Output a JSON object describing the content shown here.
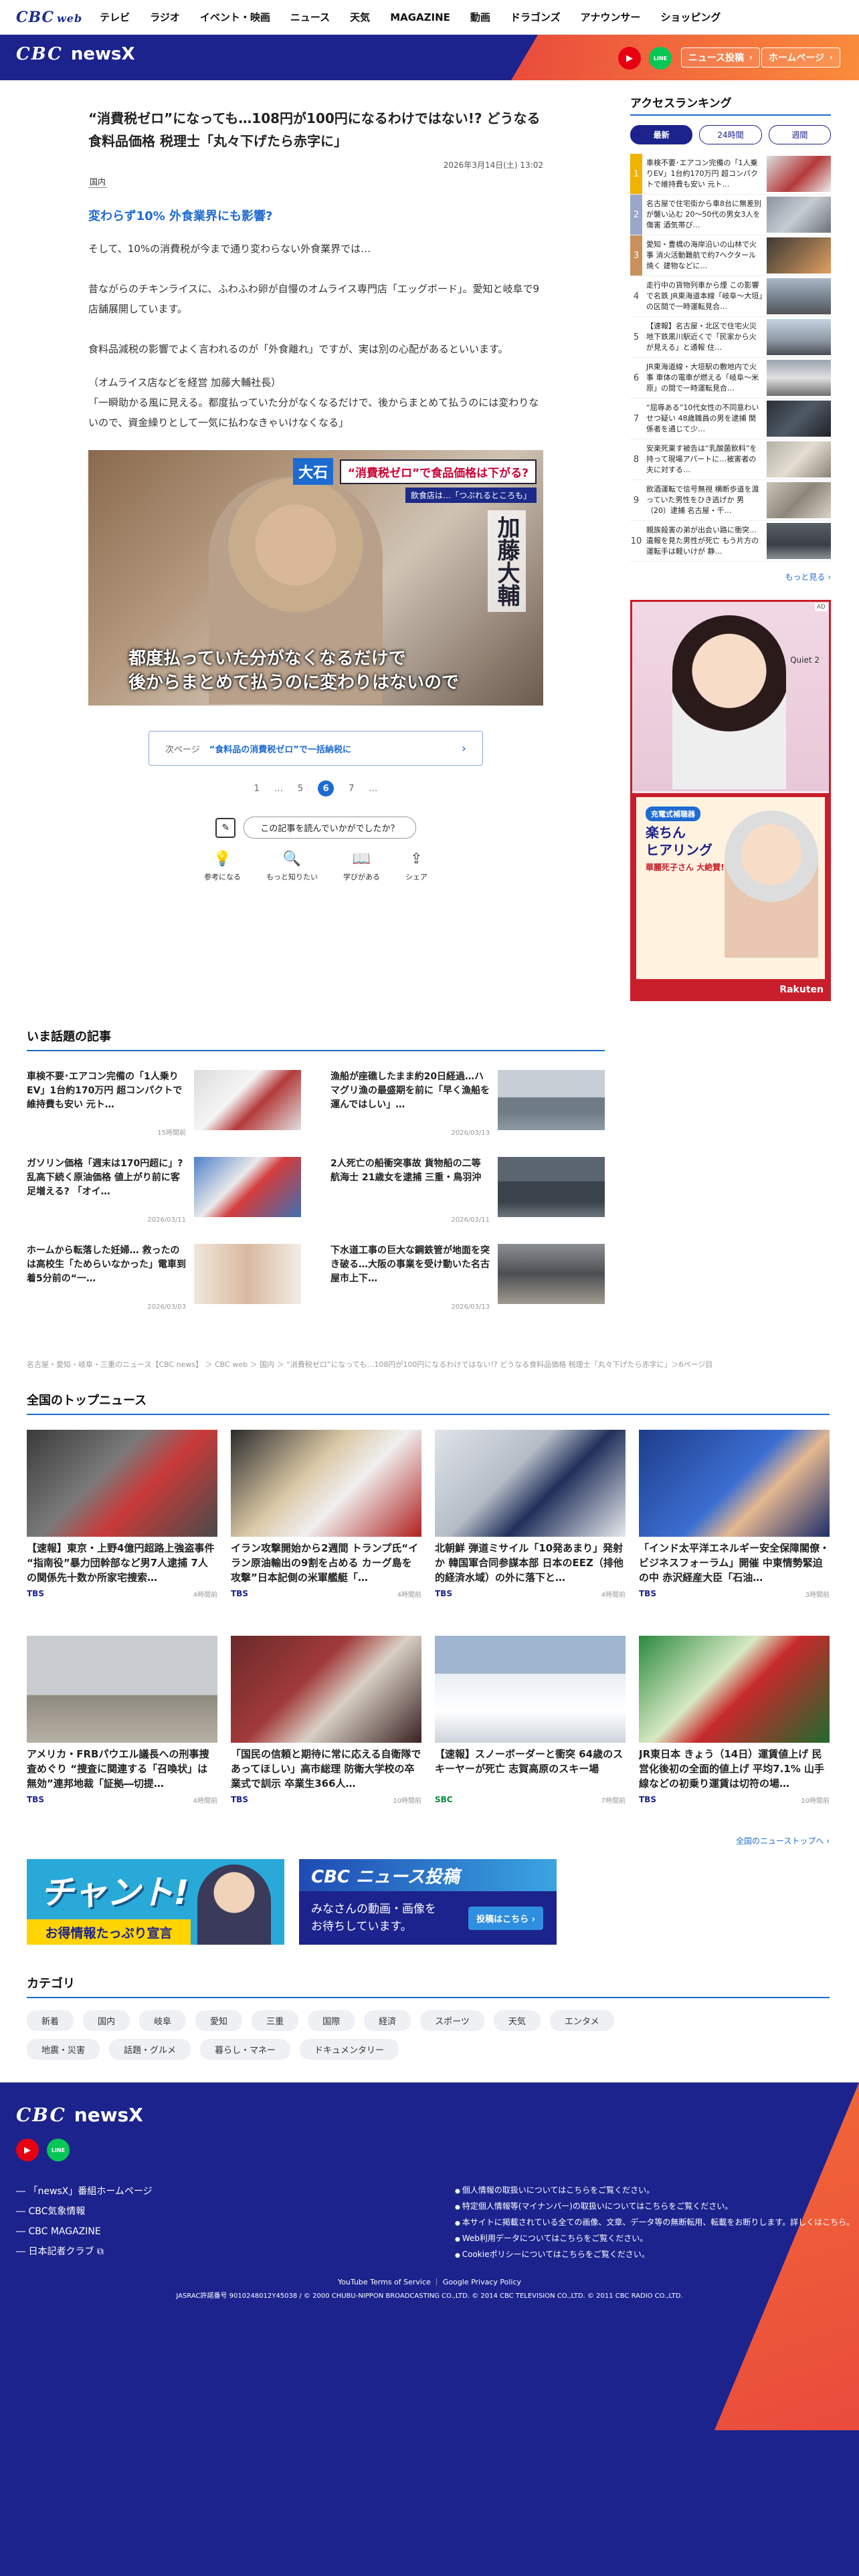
{
  "topnav": {
    "logo_cbc": "CBC",
    "logo_web": "web",
    "items": [
      "テレビ",
      "ラジオ",
      "イベント・映画",
      "ニュース",
      "天気",
      "MAGAZINE",
      "動画",
      "ドラゴンズ",
      "アナウンサー",
      "ショッピング"
    ]
  },
  "header": {
    "logo_cbc": "CBC",
    "logo_newsx": "newsX",
    "youtube": "▶",
    "line": "LINE",
    "btn_submit": "ニュース投稿",
    "btn_home": "ホームページ"
  },
  "article": {
    "title": "“消費税ゼロ”になっても…108円が100円になるわけではない!? どうなる食料品価格 税理士「丸々下げたら赤字に」",
    "date": "2026年3月14日(土) 13:02",
    "tag": "国内",
    "subhead": "変わらず10% 外食業界にも影響?",
    "p1": "そして、10%の消費税が今まで通り変わらない外食業界では…",
    "p2": "昔ながらのチキンライスに、ふわふわ卵が自慢のオムライス専門店「エッグボード」。愛知と岐阜で9店舗展開しています。",
    "p3": "食料品減税の影響でよく言われるのが「外食離れ」ですが、実は別の心配があるといいます。",
    "p4": "（オムライス店などを経営 加藤大輔社長）\n「一瞬助かる風に見える。都度払っていた分がなくなるだけで、後からまとめて払うのには変わりないので、資金繰りとして一気に払わなきゃいけなくなる」",
    "photo": {
      "ohishi": "大石",
      "banner": "“消費税ゼロ”で食品価格は下がる?",
      "banner_sub": "飲食店は…「つぶれるところも」",
      "name": "加藤大輔",
      "caption_1": "都度払っていた分がなくなるだけで",
      "caption_2": "後からまとめて払うのに変わりはないので"
    },
    "next_label": "次ページ",
    "next_title": "“食料品の消費税ゼロ”で一括納税に",
    "next_chev": "›",
    "pages": [
      "1",
      "…",
      "5",
      "6",
      "7",
      "…"
    ],
    "feedback_q": "この記事を読んでいかがでしたか？",
    "reactions": [
      {
        "icon": "💡",
        "label": "参考になる"
      },
      {
        "icon": "🔍",
        "label": "もっと知りたい"
      },
      {
        "icon": "📖",
        "label": "学びがある"
      },
      {
        "icon": "⇪",
        "label": "シェア"
      }
    ]
  },
  "hot": {
    "title": "いま話題の記事",
    "items": [
      {
        "t": "車検不要･エアコン完備の「1人乗りEV」1台約170万円 超コンパクトで維持費も安い 元ト…",
        "d": "15時間前"
      },
      {
        "t": "漁船が座礁したまま約20日経過…ハマグリ漁の最盛期を前に「早く漁船を運んではしい」…",
        "d": "2026/03/13"
      },
      {
        "t": "ガソリン価格「週末は170円超に」? 乱高下続く原油価格 値上がり前に客足増える? 「オイ…",
        "d": "2026/03/11"
      },
      {
        "t": "2人死亡の船衝突事故 貨物船の二等航海士 21歳女を逮捕 三重・鳥羽沖",
        "d": "2026/03/11"
      },
      {
        "t": "ホームから転落した妊婦… 救ったのは高校生「ためらいなかった」電車到着5分前の“一…",
        "d": "2026/03/03"
      },
      {
        "t": "下水道工事の巨大な鋼鉄管が地面を突き破る…大阪の事業を受け動いた名古屋市上下…",
        "d": "2026/03/13"
      }
    ]
  },
  "breadcrumb": "名古屋・愛知・岐阜・三重のニュース【CBC news】 ＞ CBC web ＞ 国内 ＞ “消費税ゼロ”になっても…108円が100円になるわけではない!? どうなる食料品価格 税理士「丸々下げたら赤字に」＞6ページ目",
  "national": {
    "title": "全国のトップニュース",
    "more": "全国のニューストップへ ›",
    "items": [
      {
        "t": "【速報】東京・上野4億円超路上強盗事件 “指南役”暴力団幹部など男7人逮捕 7人の関係先十数か所家宅捜索…",
        "src": "TBS",
        "d": "4時間前"
      },
      {
        "t": "イラン攻撃開始から2週間 トランプ氏“イラン原油輸出の9割を占める カーグ島を攻撃”日本記側の米軍艦艇「…",
        "src": "TBS",
        "d": "4時間前"
      },
      {
        "t": "北朝鮮 弾道ミサイル「10発あまり」発射か 韓国軍合同参謀本部 日本のEEZ（排他的経済水域）の外に落下と…",
        "src": "TBS",
        "d": "4時間前"
      },
      {
        "t": "「インド太平洋エネルギー安全保障閣僚・ビジネスフォーラム」開催 中東情勢緊迫の中 赤沢経産大臣「石油…",
        "src": "TBS",
        "d": "3時間前"
      },
      {
        "t": "アメリカ・FRBパウエル議長への刑事捜査めぐり “捜査に関連する「召喚状」は無効”連邦地裁「証拠―切提…",
        "src": "TBS",
        "d": "4時間前"
      },
      {
        "t": "「国民の信頼と期待に常に応える自衛隊であってほしい」高市総理 防衛大学校の卒業式で訓示 卒業生366人…",
        "src": "TBS",
        "d": "10時間前"
      },
      {
        "t": "【速報】スノーボーダーと衝突 64歳のスキーヤーが死亡 志賀高原のスキー場",
        "src": "SBC",
        "d": "7時間前"
      },
      {
        "t": "JR東日本 きょう（14日）運賃値上げ 民営化後初の全面的値上げ 平均7.1% 山手線などの初乗り運賃は切符の場…",
        "src": "TBS",
        "d": "10時間前"
      }
    ]
  },
  "banners": {
    "chant_big": "チャント!",
    "chant_sm": "お得情報たっぷり宣言",
    "submit_top": "CBC ニュース投稿",
    "submit_txt": "みなさんの動画・画像を\nお待ちしています。",
    "submit_btn": "投稿はこちら ›"
  },
  "categories": {
    "title": "カテゴリ",
    "items": [
      "新着",
      "国内",
      "岐阜",
      "愛知",
      "三重",
      "国際",
      "経済",
      "スポーツ",
      "天気",
      "エンタメ",
      "地震・災害",
      "話題・グルメ",
      "暮らし・マネー",
      "ドキュメンタリー"
    ]
  },
  "footer": {
    "logo_cbc": "CBC",
    "logo_newsx": "newsX",
    "links": [
      "「newsX」番組ホームページ",
      "CBC気象情報",
      "CBC MAGAZINE",
      "日本記者クラブ ⧉"
    ],
    "legal": [
      "個人情報の取扱いについてはこちらをご覧ください。",
      "特定個人情報等(マイナンバー)の取扱いについてはこちらをご覧ください。",
      "本サイトに掲載されている全ての画像、文章、データ等の無断転用、転載をお断りします。詳しくはこちら。",
      "Web利用データについてはこちらをご覧ください。",
      "Cookieポリシーについてはこちらをご覧ください。"
    ],
    "yt_links": "YouTube Terms of Service ｜ Google Privacy Policy",
    "copy": "JASRAC許諾番号 9010248012Y45038 / © 2000 CHUBU-NIPPON BROADCASTING CO.,LTD. © 2014 CBC TELEVISION CO.,LTD. © 2011 CBC RADIO CO.,LTD."
  },
  "sidebar": {
    "title": "アクセスランキング",
    "tabs": [
      "最新",
      "24時間",
      "週間"
    ],
    "items": [
      "車検不要･エアコン完備の「1人乗りEV」1台約170万円 超コンパクトで維持費も安い 元ト…",
      "名古屋で住宅街から車8台に無差別が襲い込む 20〜50代の男女3人を傷害 酒気帯び…",
      "愛知・豊橋の海岸沿いの山林で火事 消火活動難航で約7ヘクタール焼く 建物などに…",
      "走行中の貨物列車から煙 この影響で名鉄 JR東海道本線「岐阜〜大垣」の区間で一時運転見合…",
      "【速報】名古屋・北区で住宅火災 地下鉄黒川駅近くで「民家から火が見える」と通報 住…",
      "JR東海道線・大垣駅の敷地内で火事 車体の電車が燃える「岐阜〜米原」の間で一時運転見合…",
      "“屈辱ある”10代女性の不同意わいせつ疑い 48歳職員の男を逮捕 関係者を通じて少…",
      "安楽死巣す被告は“乳酸菌飲料”を持って現場アパートに…被害者の夫に対する…",
      "飲酒運転で信号無視 横断歩道を渡っていた男性をひき逃げか 男（20）逮捕 名古屋・千…",
      "親族殺害の弟が出会い路に衝突…遺報を見た男性が死亡 もう片方の運転手は軽いけが 静…"
    ],
    "more": "もっと見る ›",
    "ad1_brand": "Quiet 2",
    "ad_badge": "充電式補聴器",
    "ad_hl": "楽ちん\nヒアリング",
    "ad_hl2": "華麗死子さん 大絶賛!",
    "ad_rakuten": "Rakuten",
    "ad_mark": "AD"
  },
  "colors": {
    "brand_navy": "#1c238d",
    "accent_blue": "#1f6bd1",
    "orange": "#f36b37"
  }
}
